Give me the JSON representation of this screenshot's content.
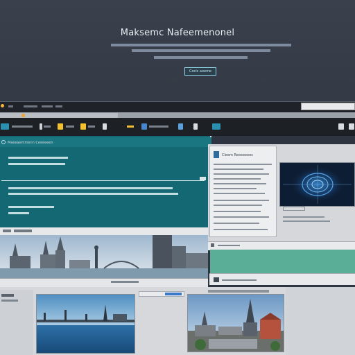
{
  "hero": {
    "title": "Maksemc Nafeemenonel",
    "cta_label": "Cocis aoeme"
  },
  "menubar": {
    "items": [
      "menu-1",
      "menu-2",
      "menu-3",
      "menu-4"
    ]
  },
  "toolbar": {
    "icon_names": [
      "grid-icon",
      "star-icon",
      "folder-icon",
      "flag-icon",
      "chart-icon",
      "image-icon",
      "document-icon",
      "settings-icon"
    ]
  },
  "teal_panel": {
    "heading": "Maeeaemmenn Ceeeeeen"
  },
  "right_panel": {
    "doc_title": "Cleem Reeeeeees"
  },
  "colors": {
    "accent_teal": "#136873",
    "accent_green": "#5aae97",
    "hero_bg": "#343a45",
    "toolbar_bg": "#1d2126",
    "cta_border": "#8fd4e8"
  }
}
